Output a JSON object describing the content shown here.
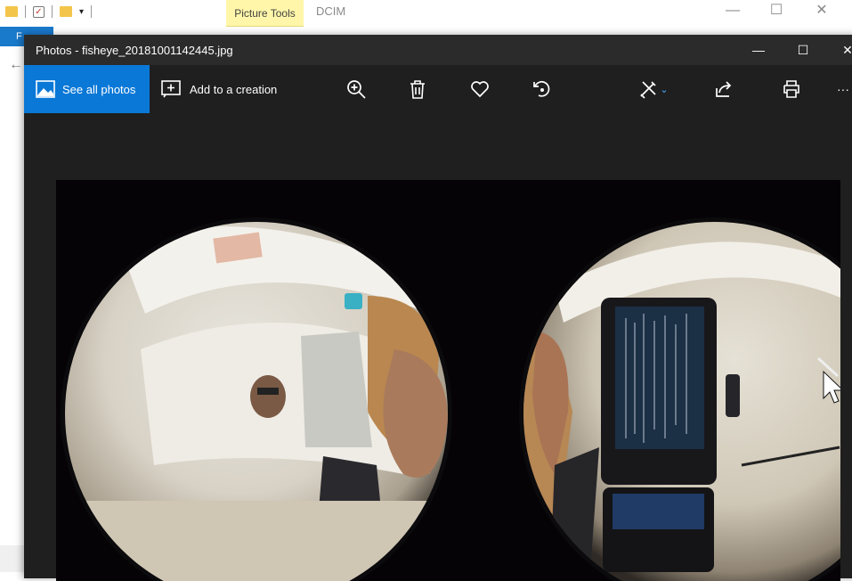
{
  "explorer": {
    "context_tab": "Picture Tools",
    "title": "DCIM",
    "file_tab": "F",
    "controls": {
      "minimize": "—",
      "maximize": "☐",
      "close": "✕"
    }
  },
  "photos_window": {
    "title": "Photos - fisheye_20181001142445.jpg",
    "controls": {
      "minimize": "—",
      "maximize": "☐",
      "close": "✕"
    },
    "toolbar": {
      "see_all_label": "See all photos",
      "add_creation_label": "Add to a creation",
      "more_label": "···"
    }
  },
  "colors": {
    "accent": "#0a78d7",
    "window_bg": "#1f1f1f",
    "titlebar_bg": "#2b2b2b",
    "context_tab_bg": "#fff6a9"
  },
  "icons": [
    "folder-icon",
    "checklist-icon",
    "dropdown-icon",
    "picture-icon",
    "add-creation-icon",
    "zoom-in-icon",
    "delete-icon",
    "favorite-icon",
    "rotate-icon",
    "edit-icon",
    "share-icon",
    "print-icon",
    "more-icon",
    "back-arrow-icon",
    "mouse-cursor-icon"
  ]
}
